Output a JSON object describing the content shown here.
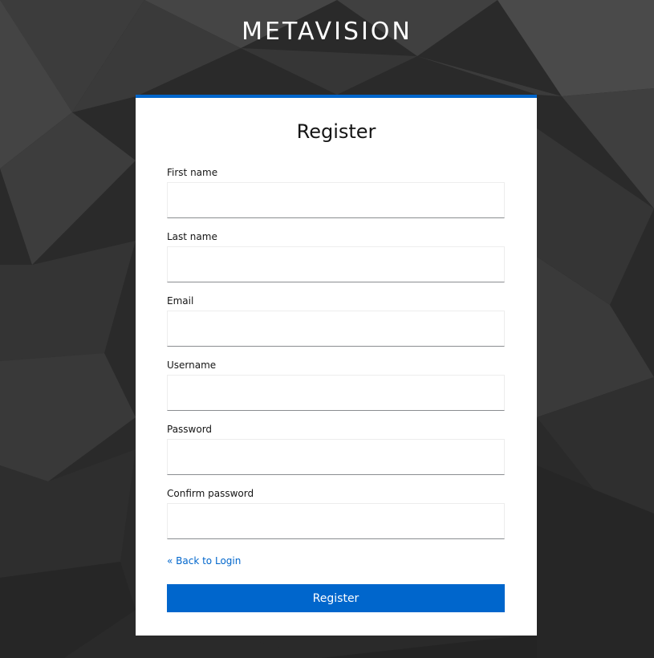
{
  "brand": {
    "title": "METAVISION"
  },
  "form": {
    "heading": "Register",
    "fields": [
      {
        "label": "First name",
        "value": "",
        "placeholder": ""
      },
      {
        "label": "Last name",
        "value": "",
        "placeholder": ""
      },
      {
        "label": "Email",
        "value": "",
        "placeholder": ""
      },
      {
        "label": "Username",
        "value": "",
        "placeholder": ""
      },
      {
        "label": "Password",
        "value": "",
        "placeholder": ""
      },
      {
        "label": "Confirm password",
        "value": "",
        "placeholder": ""
      }
    ],
    "back_link": "« Back to Login",
    "submit_label": "Register"
  },
  "colors": {
    "accent": "#0066cc",
    "background": "#2a2a2a",
    "card": "#ffffff"
  }
}
